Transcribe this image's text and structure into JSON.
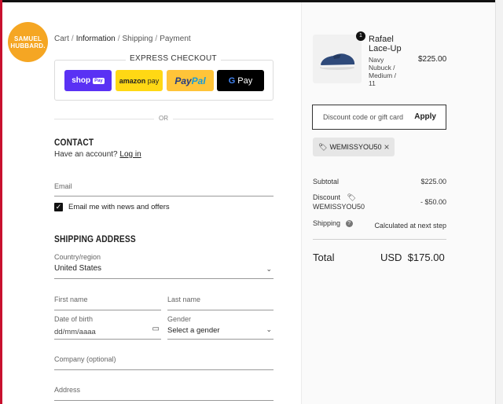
{
  "brand": {
    "logo_line1": "SAMUEL",
    "logo_line2": "HUBBARD."
  },
  "breadcrumb": {
    "items": [
      "Cart",
      "Information",
      "Shipping",
      "Payment"
    ],
    "separator": "/",
    "active": "Information"
  },
  "express_checkout": {
    "title": "EXPRESS CHECKOUT",
    "shop_pay": "shop",
    "shop_pay_badge": "Pay",
    "amazon_pay": "amazon",
    "amazon_pay_suffix": "pay",
    "paypal_a": "Pay",
    "paypal_b": "Pal",
    "gpay_g": "G",
    "gpay_label": "Pay"
  },
  "divider_or": "OR",
  "contact": {
    "title": "CONTACT",
    "account_prompt": "Have an account?",
    "login_link": "Log in",
    "email_label": "Email",
    "email_value": "",
    "newsletter_label": "Email me with news and offers",
    "newsletter_checked": true
  },
  "shipping": {
    "title": "SHIPPING ADDRESS",
    "country_label": "Country/region",
    "country_value": "United States",
    "first_name_label": "First name",
    "last_name_label": "Last name",
    "dob_label": "Date of birth",
    "dob_placeholder": "dd/mm/aaaa",
    "gender_label": "Gender",
    "gender_value": "Select a gender",
    "company_label": "Company (optional)",
    "address_label": "Address"
  },
  "order": {
    "product": {
      "name": "Rafael Lace-Up",
      "variant": "Navy Nubuck / Medium / 11",
      "price": "$225.00",
      "quantity": "1"
    },
    "discount_placeholder": "Discount code or gift card",
    "apply_label": "Apply",
    "applied_code": "WEMISSYOU50",
    "subtotal_label": "Subtotal",
    "subtotal_value": "$225.00",
    "discount_label": "Discount",
    "discount_code": "WEMISSYOU50",
    "discount_value": "- $50.00",
    "shipping_label": "Shipping",
    "shipping_help": "?",
    "shipping_value": "Calculated at next step",
    "total_label": "Total",
    "total_currency": "USD",
    "total_value": "$175.00"
  },
  "colors": {
    "logo": "#f5a623",
    "shop_pay": "#5a31f4",
    "amazon_pay": "#ffd814",
    "paypal": "#ffc439",
    "gpay": "#000000"
  }
}
